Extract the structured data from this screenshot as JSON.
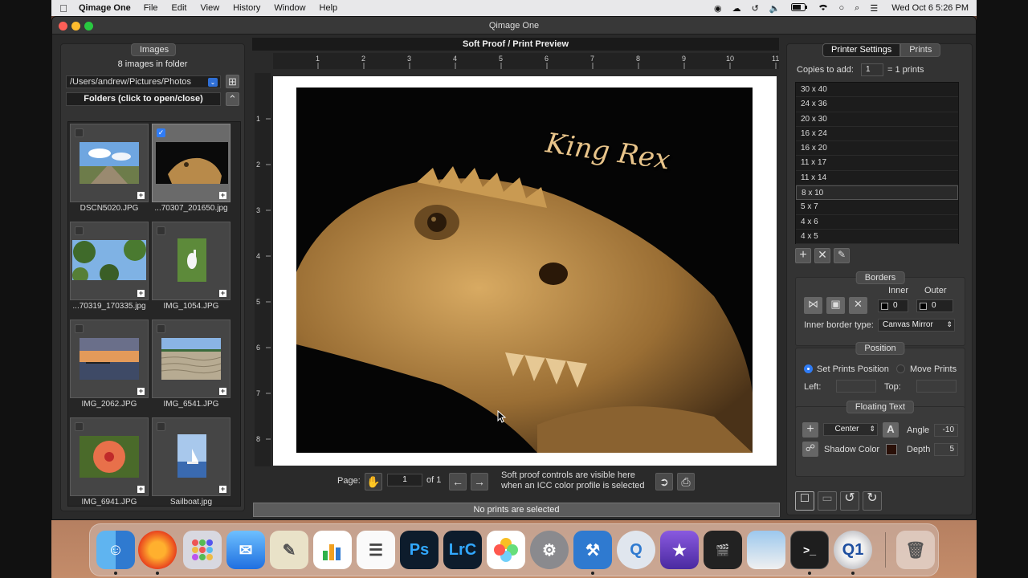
{
  "menubar": {
    "app_name": "Qimage One",
    "menus": [
      "File",
      "Edit",
      "View",
      "History",
      "Window",
      "Help"
    ],
    "clock": "Wed Oct 6  5:26 PM"
  },
  "window": {
    "title": "Qimage One"
  },
  "images_panel": {
    "title": "Images",
    "count": "8 images in folder",
    "path": "/Users/andrew/Pictures/Photos",
    "folders_button": "Folders (click to open/close)",
    "thumbs": [
      {
        "label": "DSCN5020.JPG",
        "checked": false
      },
      {
        "label": "...70307_201650.jpg",
        "checked": true
      },
      {
        "label": "...70319_170335.jpg",
        "checked": false
      },
      {
        "label": "IMG_1054.JPG",
        "checked": false
      },
      {
        "label": "IMG_2062.JPG",
        "checked": false
      },
      {
        "label": "IMG_6541.JPG",
        "checked": false
      },
      {
        "label": "IMG_6941.JPG",
        "checked": false
      },
      {
        "label": "Sailboat.jpg",
        "checked": false
      }
    ]
  },
  "preview": {
    "title": "Soft Proof / Print Preview",
    "ruler_top": [
      "1",
      "2",
      "3",
      "4",
      "5",
      "6",
      "7",
      "8",
      "9",
      "10",
      "11"
    ],
    "ruler_left": [
      "1",
      "2",
      "3",
      "4",
      "5",
      "6",
      "7",
      "8"
    ],
    "overlay_text": "King Rex",
    "page_label": "Page:",
    "page_value": "1",
    "page_of": "of 1",
    "hint_line1": "Soft proof controls are visible here",
    "hint_line2": "when an ICC color profile is selected",
    "status": "No prints are selected"
  },
  "settings_panel": {
    "tabs": [
      "Printer Settings",
      "Prints"
    ],
    "copies_label": "Copies to add:",
    "copies_value": "1",
    "copies_result": "= 1 prints",
    "sizes": [
      "30 x 40",
      "24 x 36",
      "20 x 30",
      "16 x 24",
      "16 x 20",
      "11 x 17",
      "11 x 14",
      "8 x 10",
      "5 x 7",
      "4 x 6",
      "4 x 5"
    ],
    "selected_size": "8 x 10",
    "borders": {
      "title": "Borders",
      "inner_label": "Inner",
      "outer_label": "Outer",
      "inner_value": "0",
      "outer_value": "0",
      "type_label": "Inner border type:",
      "type_value": "Canvas Mirror"
    },
    "position": {
      "title": "Position",
      "set_label": "Set Prints Position",
      "move_label": "Move Prints",
      "left_label": "Left:",
      "top_label": "Top:"
    },
    "floating_text": {
      "title": "Floating Text",
      "align_value": "Center",
      "angle_label": "Angle",
      "angle_value": "-10",
      "shadow_label": "Shadow Color",
      "depth_label": "Depth",
      "depth_value": "5"
    }
  },
  "dock": {
    "apps": [
      "Finder",
      "Firefox",
      "Launchpad",
      "Mail",
      "Preview",
      "Numbers",
      "TextEdit",
      "Photoshop",
      "Lightroom Classic",
      "Photos",
      "System Preferences",
      "Xcode",
      "QuickTime",
      "iMovie",
      "Final Cut",
      "Preview Photos",
      "Terminal",
      "Qimage One",
      "Trash"
    ]
  },
  "colors": {
    "accent_blue": "#2f7cf6",
    "window_bg": "#2a2a2a",
    "panel_bg": "#333333"
  }
}
